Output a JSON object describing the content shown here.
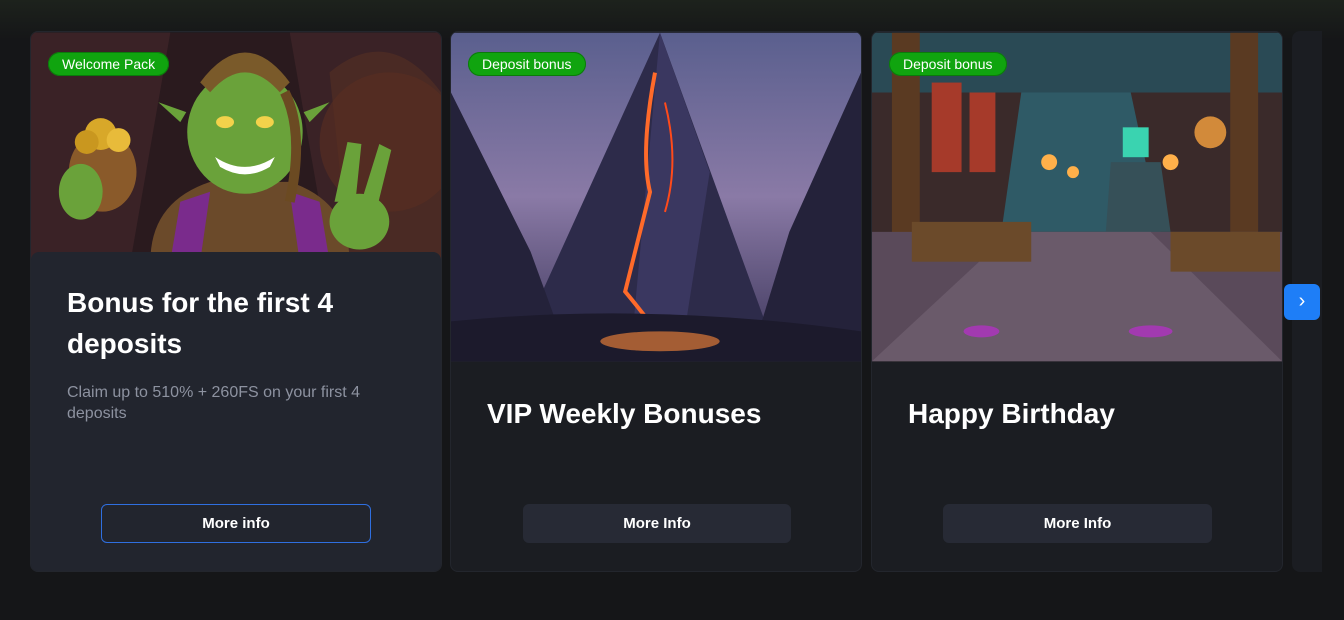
{
  "cards": [
    {
      "badge": "Welcome Pack",
      "title": "Bonus for the first 4 deposits",
      "description": "Claim up to 510% + 260FS on your first 4 deposits",
      "button": "More info"
    },
    {
      "badge": "Deposit bonus",
      "title": "VIP Weekly Bonuses",
      "button": "More Info"
    },
    {
      "badge": "Deposit bonus",
      "title": "Happy Birthday",
      "button": "More Info"
    }
  ],
  "carousel": {
    "next_icon": "›"
  },
  "colors": {
    "accent": "#1e7ef7",
    "badge": "#10a40f",
    "card_bg": "#1b1d22",
    "page_bg": "#151618"
  }
}
